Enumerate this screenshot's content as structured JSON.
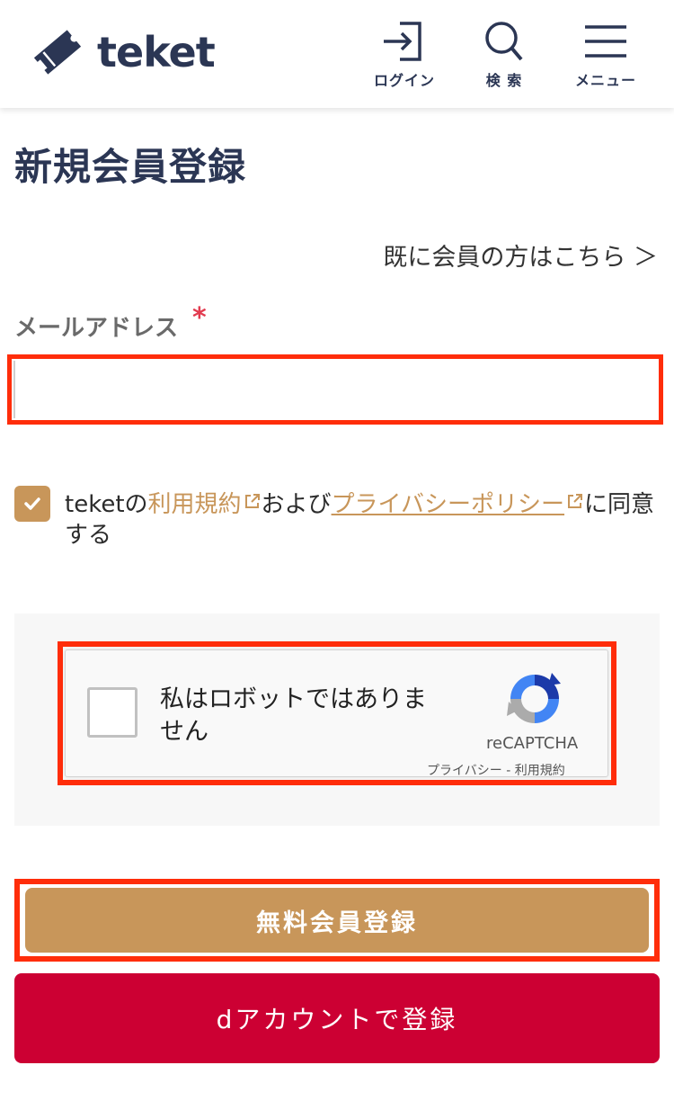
{
  "header": {
    "logo_text": "teket",
    "nav": {
      "login_label": "ログイン",
      "search_label": "検 索",
      "menu_label": "メニュー"
    }
  },
  "page": {
    "title": "新規会員登録",
    "existing_member_link": "既に会員の方はこちら ＞"
  },
  "form": {
    "email_label": "メールアドレス",
    "required_mark": "*",
    "email_value": "",
    "agree": {
      "checked": true,
      "prefix": "teketの",
      "terms_link": "利用規約",
      "middle": "および",
      "privacy_link": "プライバシーポリシー",
      "suffix": "に同意する"
    }
  },
  "captcha": {
    "checkbox_label": "私はロボットではありません",
    "brand": "reCAPTCHA",
    "privacy": "プライバシー",
    "separator": "-",
    "terms": "利用規約"
  },
  "buttons": {
    "register": "無料会員登録",
    "daccount": "dアカウントで登録"
  },
  "colors": {
    "brand_navy": "#2b3654",
    "accent_tan": "#c8965a",
    "daccount_red": "#cc0033",
    "highlight_red": "#ff2d0a",
    "required_red": "#e23b4f"
  }
}
